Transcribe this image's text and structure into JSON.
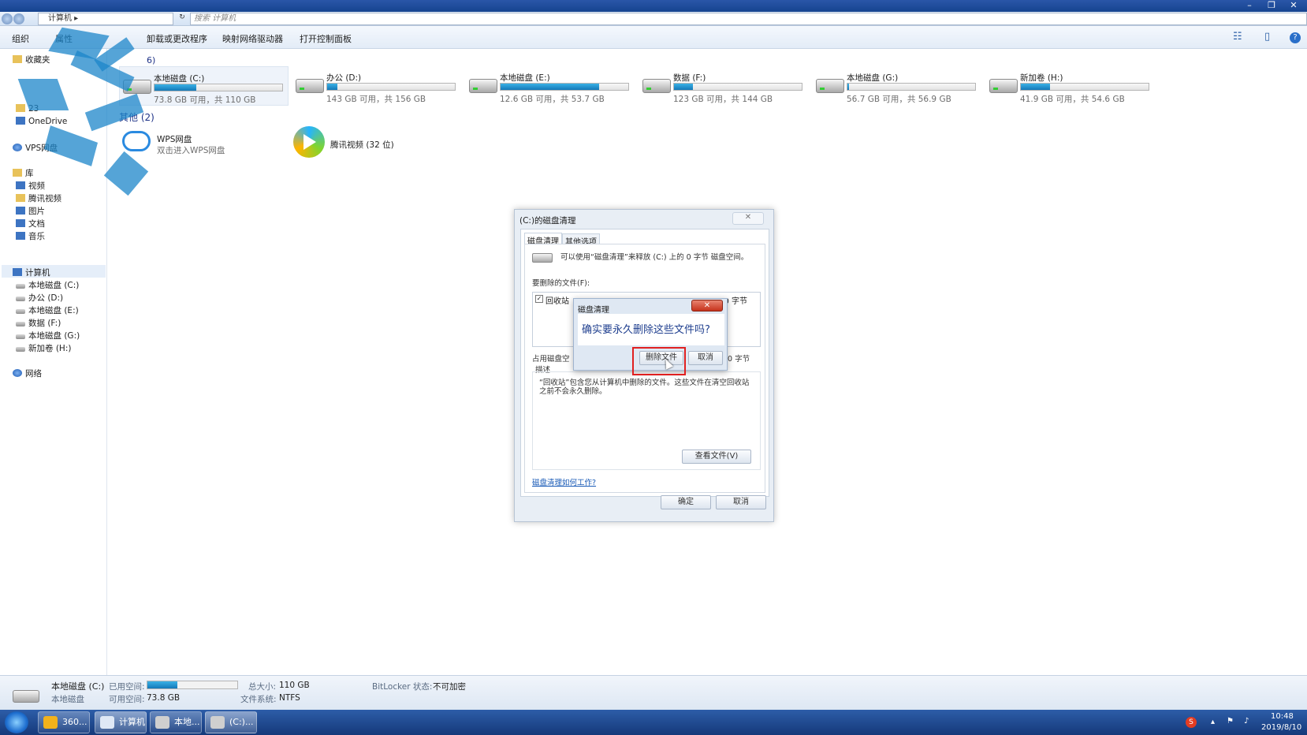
{
  "window": {
    "minimize": "–",
    "restore": "❐",
    "close": "✕"
  },
  "address": {
    "path": "计算机 ▸",
    "search_placeholder": "搜索 计算机"
  },
  "toolbar": {
    "organize": "组织",
    "properties": "属性",
    "uninstall": "卸载或更改程序",
    "map_drive": "映射网络驱动器",
    "control_panel": "打开控制面板",
    "help": "?"
  },
  "sidebar": {
    "favorites": "收藏夹",
    "item_23": "23",
    "onedrive": "OneDrive",
    "vps": "VPS网盘",
    "library": "库",
    "videos": "视频",
    "tencent": "腾讯视频",
    "pictures": "图片",
    "documents": "文档",
    "music": "音乐",
    "computer": "计算机",
    "drives": [
      "本地磁盘 (C:)",
      "办公 (D:)",
      "本地磁盘 (E:)",
      "数据 (F:)",
      "本地磁盘 (G:)",
      "新加卷 (H:)"
    ],
    "network": "网络"
  },
  "content": {
    "drives_header_fragment": "6)",
    "other_header": "其他 (2)",
    "drives": [
      {
        "name": "本地磁盘 (C:)",
        "info": "73.8 GB 可用，共 110 GB",
        "used_fraction": 0.33
      },
      {
        "name": "办公 (D:)",
        "info": "143 GB 可用，共 156 GB",
        "used_fraction": 0.08
      },
      {
        "name": "本地磁盘 (E:)",
        "info": "12.6 GB 可用，共 53.7 GB",
        "used_fraction": 0.77
      },
      {
        "name": "数据 (F:)",
        "info": "123 GB 可用，共 144 GB",
        "used_fraction": 0.15
      },
      {
        "name": "本地磁盘 (G:)",
        "info": "56.7 GB 可用，共 56.9 GB",
        "used_fraction": 0.01
      },
      {
        "name": "新加卷 (H:)",
        "info": "41.9 GB 可用，共 54.6 GB",
        "used_fraction": 0.23
      }
    ],
    "wps_name": "WPS网盘",
    "wps_sub": "双击进入WPS网盘",
    "tencent_name": "腾讯视频 (32 位)"
  },
  "cleanup": {
    "title": "(C:)的磁盘清理",
    "close": "✕",
    "tab_cleanup": "磁盘清理",
    "tab_more": "其他选项",
    "intro": "可以使用“磁盘清理”来释放 (C:) 上的 0 字节 磁盘空间。",
    "files_label": "要删除的文件(F):",
    "file_name": "回收站",
    "file_size": "0 字节",
    "space_label": "占用磁盘空",
    "space_value": "0 字节",
    "desc_label": "描述",
    "desc_text": "“回收站”包含您从计算机中删除的文件。这些文件在清空回收站之前不会永久删除。",
    "view_files": "查看文件(V)",
    "how_link": "磁盘清理如何工作?",
    "ok": "确定",
    "cancel": "取消"
  },
  "confirm": {
    "title": "磁盘清理",
    "close": "✕",
    "question": "确实要永久删除这些文件吗?",
    "delete": "删除文件",
    "cancel": "取消"
  },
  "details": {
    "drive_name": "本地磁盘 (C:)",
    "drive_type": "本地磁盘",
    "used_label": "已用空间:",
    "free_label": "可用空间:",
    "free_value": "73.8 GB",
    "total_label": "总大小:",
    "total_value": "110 GB",
    "fs_label": "文件系统:",
    "fs_value": "NTFS",
    "bitlocker_label": "BitLocker 状态:",
    "bitlocker_value": "不可加密",
    "used_fraction": 0.33
  },
  "taskbar": {
    "items": [
      "360...",
      "计算机",
      "本地...",
      "(C:)..."
    ],
    "time": "10:48",
    "date": "2019/8/10"
  }
}
